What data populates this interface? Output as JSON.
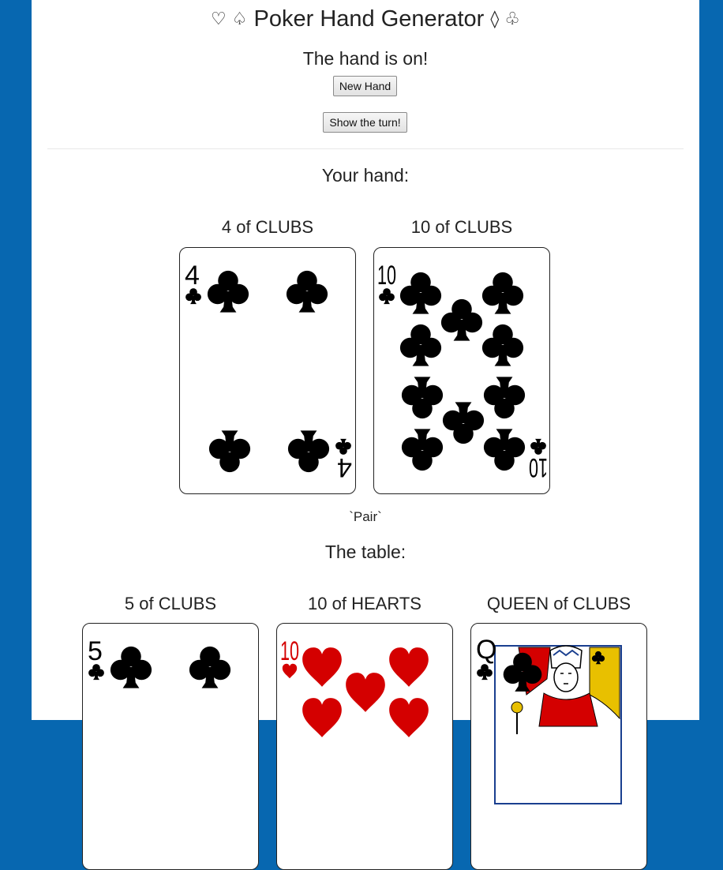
{
  "header": {
    "title": "Poker Hand Generator",
    "left_symbols": "♡ ♤",
    "right_symbols": "◊ ♧"
  },
  "status": "The hand is on!",
  "buttons": {
    "new_hand": "New Hand",
    "show_turn": "Show the turn!"
  },
  "hand": {
    "heading": "Your hand:",
    "cards": [
      {
        "label": "4 of CLUBS",
        "rank": "4",
        "suit": "clubs",
        "color": "#000000"
      },
      {
        "label": "10 of CLUBS",
        "rank": "10",
        "suit": "clubs",
        "color": "#000000"
      }
    ],
    "evaluation": "`Pair`"
  },
  "table": {
    "heading": "The table:",
    "cards": [
      {
        "label": "5 of CLUBS",
        "rank": "5",
        "suit": "clubs",
        "color": "#000000"
      },
      {
        "label": "10 of HEARTS",
        "rank": "10",
        "suit": "hearts",
        "color": "#d40000"
      },
      {
        "label": "QUEEN of CLUBS",
        "rank": "Q",
        "suit": "clubs",
        "color": "#000000"
      }
    ]
  },
  "colors": {
    "background": "#0767b0",
    "panel": "#ffffff",
    "hearts": "#d40000"
  }
}
